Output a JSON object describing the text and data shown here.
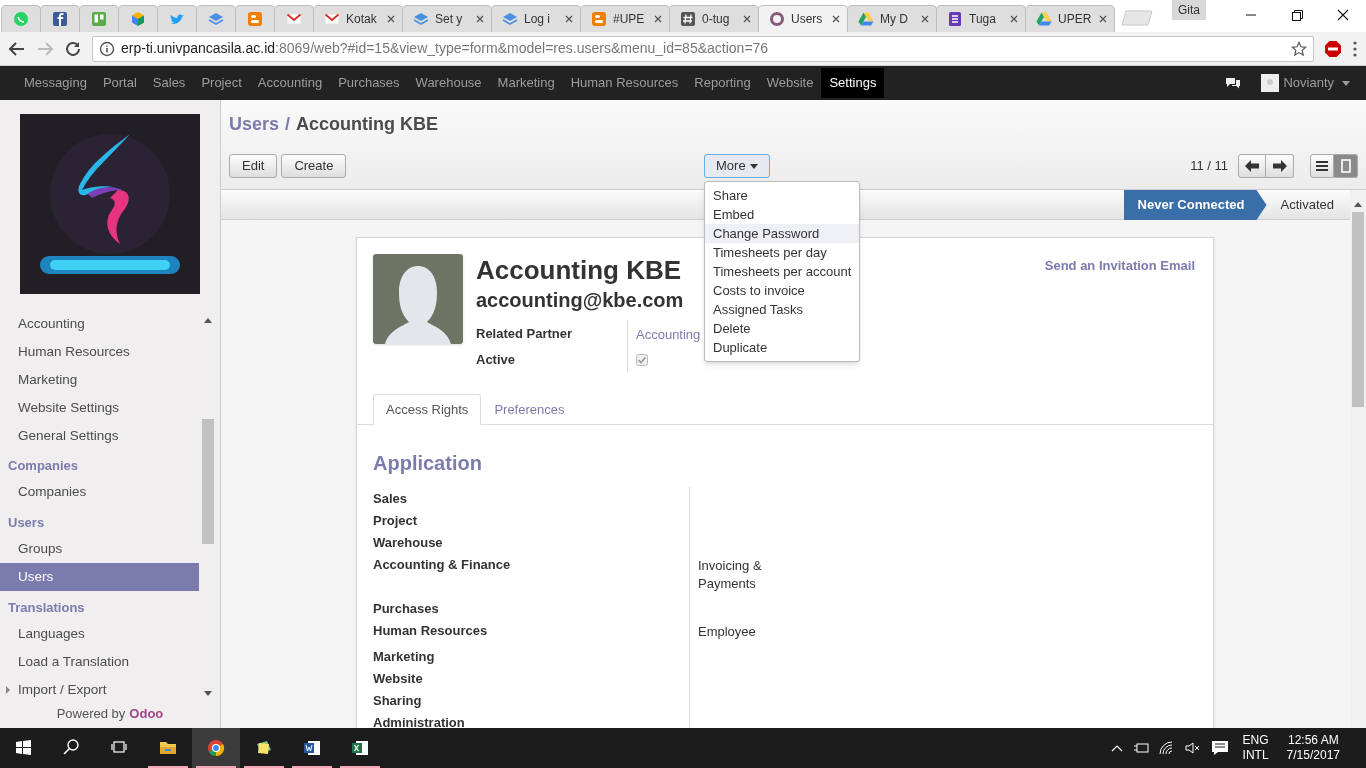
{
  "browser": {
    "tabs": [
      {
        "kind": "pinned",
        "selected": false
      },
      {
        "kind": "pinned",
        "selected": false
      },
      {
        "kind": "pinned",
        "selected": false
      },
      {
        "kind": "pinned",
        "selected": false
      },
      {
        "kind": "pinned",
        "selected": false
      },
      {
        "kind": "pinned",
        "selected": false
      },
      {
        "kind": "pinned",
        "selected": false
      },
      {
        "kind": "pinned",
        "selected": false
      },
      {
        "kind": "normal",
        "title": "Kotak",
        "selected": false
      },
      {
        "kind": "normal",
        "title": "Set y",
        "selected": false
      },
      {
        "kind": "normal",
        "title": "Log i",
        "selected": false
      },
      {
        "kind": "normal",
        "title": "#UPE",
        "selected": false
      },
      {
        "kind": "normal",
        "title": "0-tug",
        "selected": false
      },
      {
        "kind": "normal",
        "title": "Users",
        "selected": true
      },
      {
        "kind": "normal",
        "title": "My D",
        "selected": false
      },
      {
        "kind": "normal",
        "title": "Tuga",
        "selected": false
      },
      {
        "kind": "normal",
        "title": "UPER",
        "selected": false
      }
    ],
    "profile": "Gita",
    "address": {
      "host": "erp-ti.univpancasila.ac.id",
      "path": ":8069/web?#id=15&view_type=form&model=res.users&menu_id=85&action=76"
    }
  },
  "top_menu": [
    {
      "label": "Messaging",
      "selected": false
    },
    {
      "label": "Portal",
      "selected": false
    },
    {
      "label": "Sales",
      "selected": false
    },
    {
      "label": "Project",
      "selected": false
    },
    {
      "label": "Accounting",
      "selected": false
    },
    {
      "label": "Purchases",
      "selected": false
    },
    {
      "label": "Warehouse",
      "selected": false
    },
    {
      "label": "Marketing",
      "selected": false
    },
    {
      "label": "Human Resources",
      "selected": false
    },
    {
      "label": "Reporting",
      "selected": false
    },
    {
      "label": "Website",
      "selected": false
    },
    {
      "label": "Settings",
      "selected": true
    }
  ],
  "user": {
    "name": "Novianty"
  },
  "sidebar": {
    "sections": [
      {
        "items": [
          {
            "label": "Accounting",
            "kind": "link",
            "selected": false
          },
          {
            "label": "Human Resources",
            "kind": "link",
            "selected": false
          },
          {
            "label": "Marketing",
            "kind": "link",
            "selected": false
          },
          {
            "label": "Website Settings",
            "kind": "link",
            "selected": false
          },
          {
            "label": "General Settings",
            "kind": "link",
            "selected": false
          }
        ]
      },
      {
        "heading": "Companies",
        "items": [
          {
            "label": "Companies",
            "kind": "link",
            "selected": false
          }
        ]
      },
      {
        "heading": "Users",
        "items": [
          {
            "label": "Groups",
            "kind": "link",
            "selected": false
          },
          {
            "label": "Users",
            "kind": "link",
            "selected": true
          }
        ]
      },
      {
        "heading": "Translations",
        "items": [
          {
            "label": "Languages",
            "kind": "link",
            "selected": false
          },
          {
            "label": "Load a Translation",
            "kind": "link",
            "selected": false
          },
          {
            "label": "Import / Export",
            "kind": "group",
            "expanded": false,
            "selected": false
          }
        ]
      }
    ],
    "footer": {
      "text": "Powered by",
      "brand": "Odoo"
    }
  },
  "breadcrumb": {
    "separator": "/",
    "items": [
      {
        "label": "Users",
        "kind": "link"
      },
      {
        "label": "Accounting KBE",
        "kind": "current"
      }
    ]
  },
  "buttons": [
    "Edit",
    "Create"
  ],
  "more_menu": {
    "label": "More",
    "expanded": true,
    "items": [
      {
        "label": "Share",
        "highlighted": false
      },
      {
        "label": "Embed",
        "highlighted": false
      },
      {
        "label": "Change Password",
        "highlighted": true
      },
      {
        "label": "Timesheets per day",
        "highlighted": false
      },
      {
        "label": "Timesheets per account",
        "highlighted": false
      },
      {
        "label": "Costs to invoice",
        "highlighted": false
      },
      {
        "label": "Assigned Tasks",
        "highlighted": false
      },
      {
        "label": "Delete",
        "highlighted": false
      },
      {
        "label": "Duplicate",
        "highlighted": false
      }
    ]
  },
  "pager": "11 / 11",
  "view_switcher": [
    {
      "kind": "list",
      "selected": false
    },
    {
      "kind": "form",
      "selected": true
    }
  ],
  "status_bar": [
    {
      "label": "Never Connected",
      "selected": true
    },
    {
      "label": "Activated",
      "selected": false
    }
  ],
  "form": {
    "name": "Accounting KBE",
    "email": "accounting@kbe.com",
    "send_invitation": "Send an Invitation Email",
    "fields": [
      {
        "label": "Related Partner",
        "kind": "link",
        "value": "Accounting"
      },
      {
        "label": "Active",
        "kind": "checkbox",
        "checked": true,
        "disabled": true
      }
    ],
    "tabs": [
      {
        "label": "Access Rights",
        "selected": true
      },
      {
        "label": "Preferences",
        "selected": false
      }
    ],
    "section_title": "Application",
    "access_rows": [
      {
        "label": "Sales"
      },
      {
        "label": "Project"
      },
      {
        "label": "Warehouse"
      },
      {
        "label": "Accounting & Finance",
        "value": "Invoicing & Payments"
      },
      {
        "label": "Purchases"
      },
      {
        "label": "Human Resources",
        "value": "Employee"
      },
      {
        "label": "Marketing"
      },
      {
        "label": "Website"
      },
      {
        "label": "Sharing"
      },
      {
        "label": "Administration"
      }
    ]
  },
  "taskbar": {
    "apps": [
      {
        "kind": "start"
      },
      {
        "kind": "search"
      },
      {
        "kind": "task_view"
      },
      {
        "kind": "explorer",
        "running": true,
        "selected": false
      },
      {
        "kind": "chrome",
        "running": true,
        "selected": true
      },
      {
        "kind": "stickies",
        "running": true,
        "selected": false
      },
      {
        "kind": "word",
        "running": true,
        "selected": false
      },
      {
        "kind": "excel",
        "running": true,
        "selected": false
      }
    ],
    "tray": {
      "language": "ENG",
      "layout": "INTL",
      "time": "12:56 AM",
      "date": "7/15/2017"
    }
  }
}
